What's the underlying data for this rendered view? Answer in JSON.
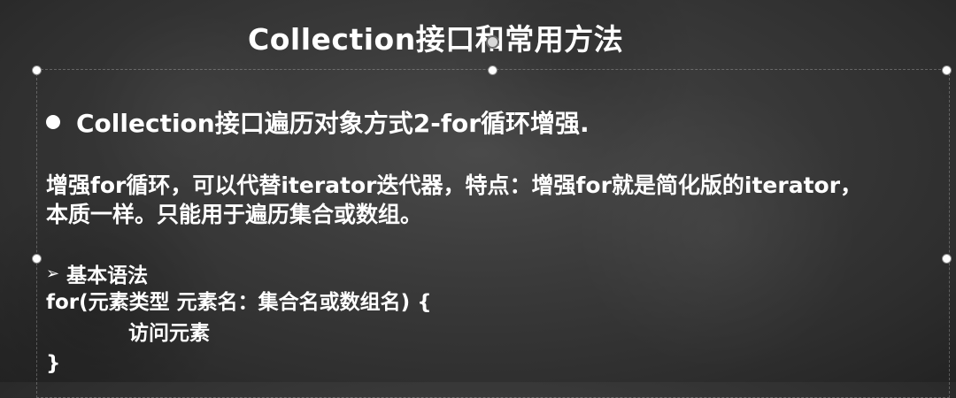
{
  "slide": {
    "title": "Collection接口和常用方法",
    "bullet": "Collection接口遍历对象方式2-for循环增强.",
    "paragraph_line1": "增强for循环，可以代替iterator迭代器，特点：增强for就是简化版的iterator，",
    "paragraph_line2": "本质一样。只能用于遍历集合或数组。",
    "syntax_heading": "基本语法",
    "code_line1": "for(元素类型 元素名：集合名或数组名) {",
    "code_line2": "访问元素",
    "code_line3": "}"
  },
  "icons": {
    "bullet": "bullet-dot-icon",
    "syntax_arrow": "arrow-right-icon",
    "rotate": "rotate-handle-icon"
  },
  "colors": {
    "background": "#3a3a3a",
    "text": "#ffffff"
  }
}
